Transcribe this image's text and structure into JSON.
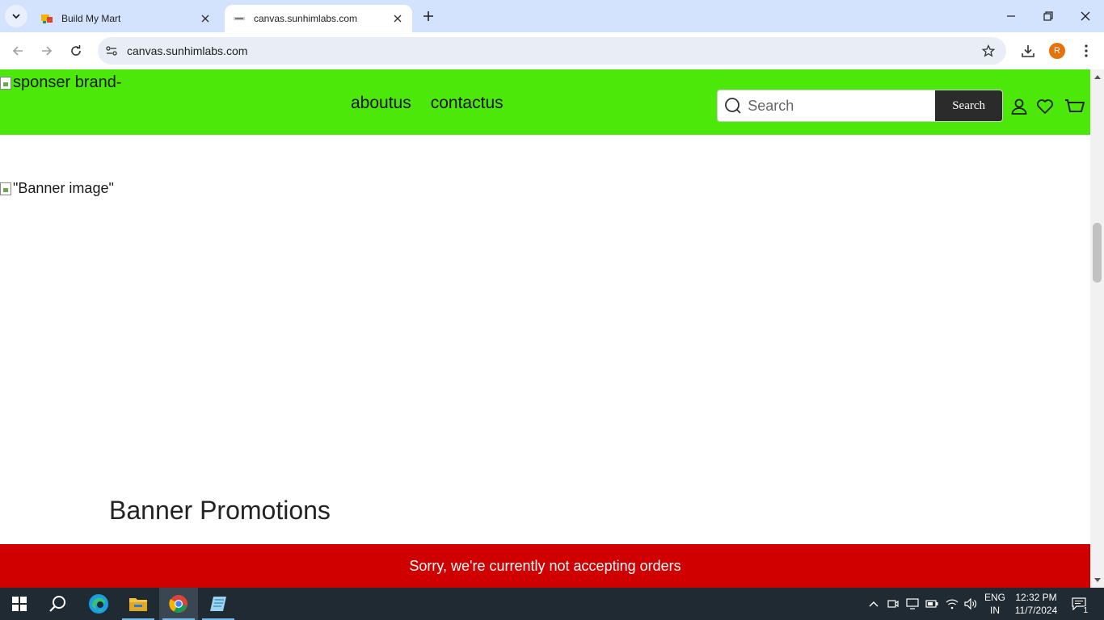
{
  "browser": {
    "tabs": [
      {
        "title": "Build My Mart",
        "active": false
      },
      {
        "title": "canvas.sunhimlabs.com",
        "active": true
      }
    ],
    "url": "canvas.sunhimlabs.com",
    "profile_initial": "R"
  },
  "site": {
    "header_bg": "#4ce80a",
    "brand_alt": "sponser brand-",
    "nav": [
      "aboutus",
      "contactus"
    ],
    "search_placeholder": "Search",
    "search_button": "Search",
    "banner_alt": "\"Banner image\"",
    "section_title": "Banner Promotions",
    "notice": "Sorry, we're currently not accepting orders",
    "notice_bg": "#d10000"
  },
  "taskbar": {
    "language": "ENG",
    "region": "IN",
    "time": "12:32 PM",
    "date": "11/7/2024",
    "notifications": "1"
  }
}
